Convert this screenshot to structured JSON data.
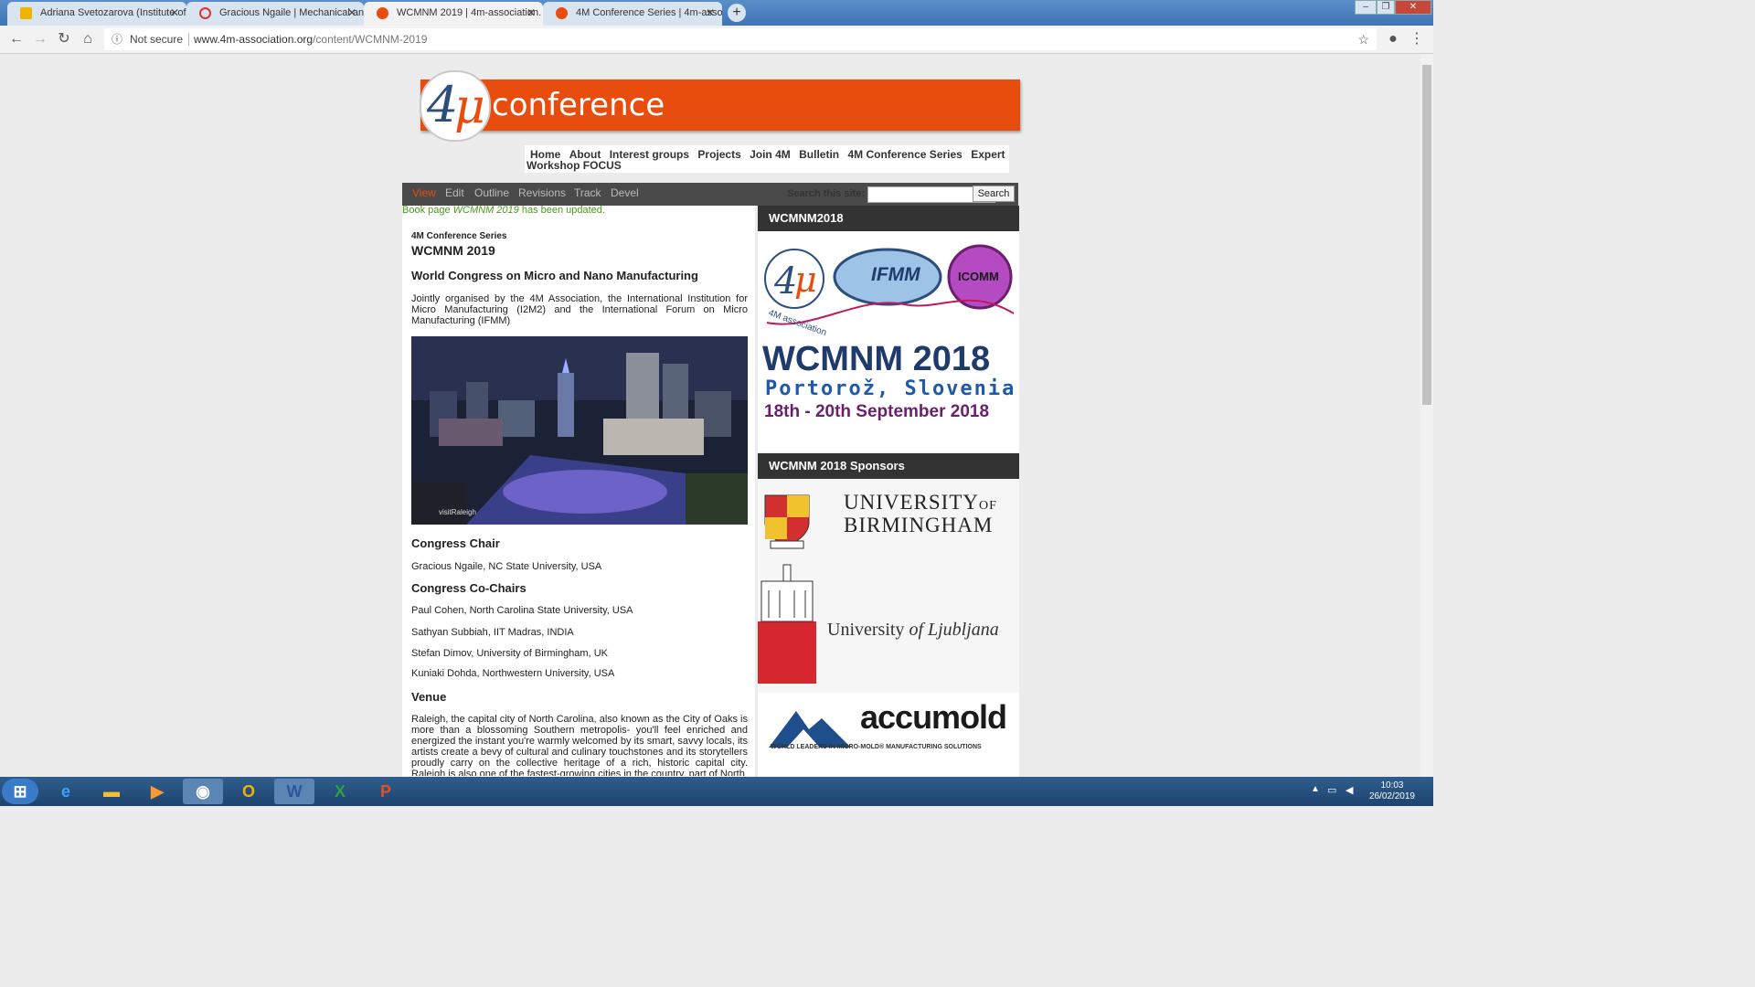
{
  "browser": {
    "tabs": [
      {
        "title": "Adriana Svetozarova (Institute of",
        "active": false,
        "icon": "outlook-icon"
      },
      {
        "title": "Gracious Ngaile | Mechanical and",
        "active": false,
        "icon": "blocked-icon"
      },
      {
        "title": "WCMNM 2019 | 4m-association.",
        "active": true,
        "icon": "4m-icon"
      },
      {
        "title": "4M Conference Series | 4m-assoc",
        "active": false,
        "icon": "4m-icon"
      }
    ],
    "address": {
      "security": "Not secure",
      "url_host": "www.4m-association.org",
      "url_path": "/content/WCMNM-2019"
    }
  },
  "site": {
    "logo_text": "conference",
    "menu": [
      "Home",
      "About",
      "Interest groups",
      "Projects",
      "Join 4M",
      "Bulletin",
      "4M Conference Series",
      "Expert"
    ],
    "menu_wrap": "Workshop FOCUS",
    "local_tabs": [
      "View",
      "Edit",
      "Outline",
      "Revisions",
      "Track",
      "Devel"
    ],
    "search": {
      "label": "Search this site:",
      "button": "Search",
      "value": ""
    },
    "status": {
      "prefix": "Book page ",
      "page": "WCMNM 2019",
      "suffix": " has been updated."
    }
  },
  "article": {
    "breadcrumb": "4M Conference Series",
    "title": "WCMNM 2019",
    "subtitle": "World Congress on Micro and Nano Manufacturing",
    "intro": "Jointly organised by the 4M Association, the International Institution for Micro Manufacturing (I2M2) and the International Forum on Micro Manufacturing (IFMM)",
    "photo_caption": "visitRaleigh",
    "chair_heading": "Congress Chair",
    "chair": "Gracious Ngaile, NC State University, USA",
    "cochairs_heading": "Congress Co-Chairs",
    "cochairs": [
      "Paul Cohen, North Carolina State University, USA",
      "Sathyan Subbiah, IIT Madras, INDIA",
      "Stefan Dimov, University of Birmingham, UK",
      "Kuniaki Dohda, Northwestern University, USA"
    ],
    "venue_heading": "Venue",
    "venue_text": "Raleigh, the capital city of North Carolina, also known as the City of Oaks is more than a blossoming Southern metropolis- you'll feel enriched and energized the instant you're warmly welcomed by its smart, savvy locals, its artists create a bevy of cultural and culinary touchstones and its storytellers proudly carry on the collective heritage of a rich, historic capital city. Raleigh is also one of the fastest-growing cities in the country, part of North"
  },
  "sidebar": {
    "block1_title": "WCMNM2018",
    "logos": {
      "ifmm": "IFMM",
      "icomm": "ICOMM",
      "assoc": "4M association"
    },
    "event_name": "WCMNM 2018",
    "event_place": "Portorož, Slovenia",
    "event_dates": "18th - 20th September 2018",
    "block2_title": "WCMNM 2018 Sponsors",
    "sponsors": {
      "birmingham_1": "UNIVERSITY",
      "birmingham_of": "OF",
      "birmingham_2": "BIRMINGHAM",
      "ljubljana_1": "University",
      "ljubljana_2": "of Ljubljana",
      "accumold": "accumold",
      "accumold_tag": "WORLD LEADERS IN MICRO-MOLD® MANUFACTURING SOLUTIONS"
    }
  },
  "taskbar": {
    "time": "10:03",
    "date": "26/02/2019"
  },
  "colors": {
    "brand_orange": "#e84d0e",
    "navy": "#1f3b6b",
    "purple": "#6b1e6e",
    "link_green": "#4a9a1a"
  }
}
